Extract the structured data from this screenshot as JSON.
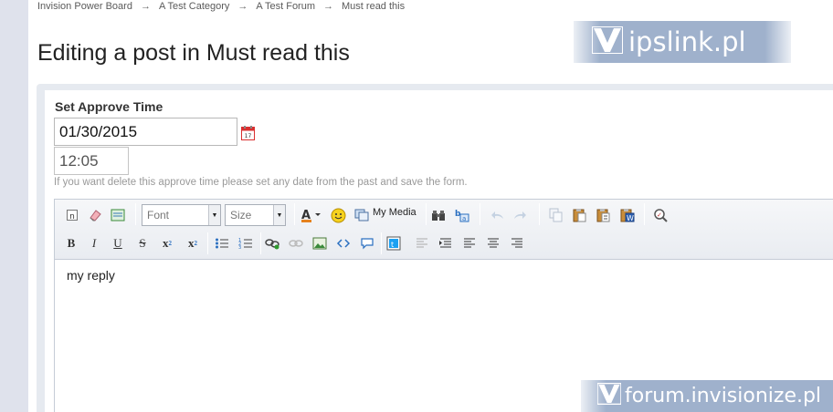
{
  "breadcrumb": {
    "items": [
      "Invision Power Board",
      "A Test Category",
      "A Test Forum",
      "Must read this"
    ],
    "separator": "→"
  },
  "page": {
    "title": "Editing a post in Must read this"
  },
  "approve": {
    "label": "Set Approve Time",
    "date_value": "01/30/2015",
    "time_value": "12:05",
    "help": "If you want delete this approve time please set any date from the past and save the form."
  },
  "toolbar": {
    "font_placeholder": "Font",
    "size_placeholder": "Size",
    "my_media_label": "My Media"
  },
  "editor": {
    "content": "my reply"
  },
  "watermarks": {
    "top": "ipslink.pl",
    "bottom": "forum.invisionize.pl"
  },
  "colors": {
    "accent": "#9fb1cc",
    "calendar": "#d93030",
    "link": "#1e5fb4"
  }
}
